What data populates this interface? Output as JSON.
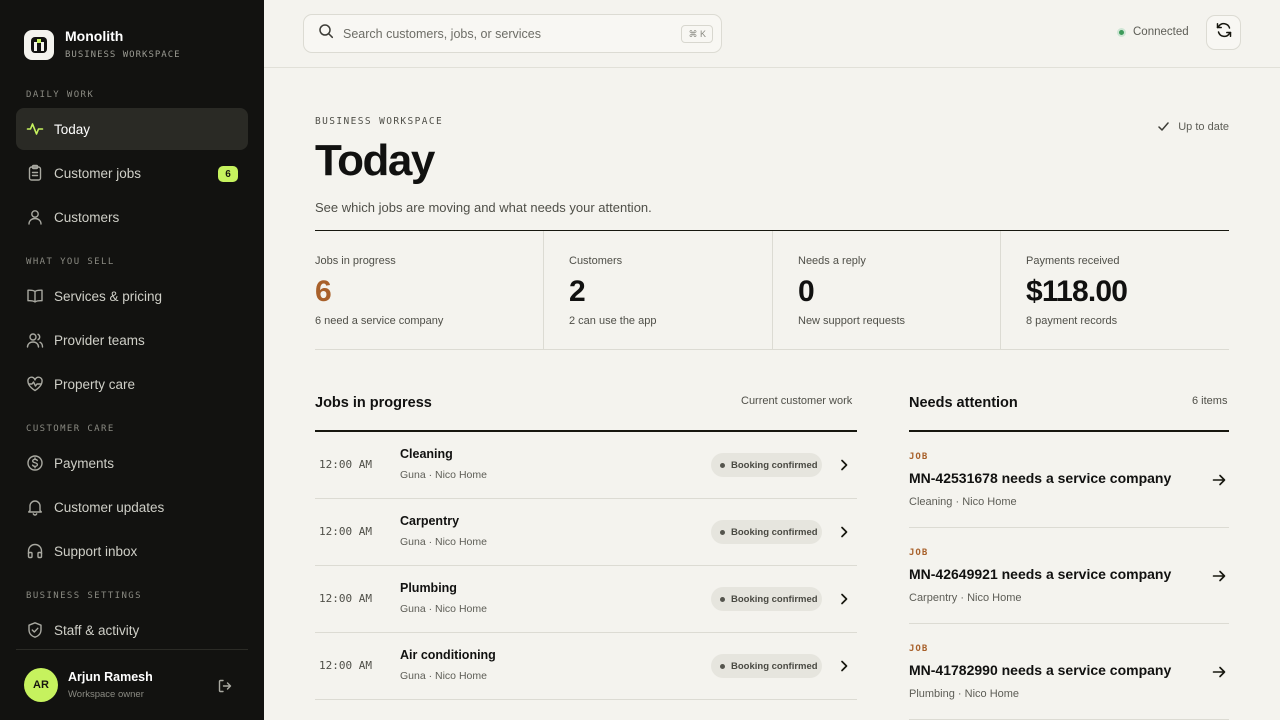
{
  "brand": {
    "name": "Monolith",
    "subtitle": "BUSINESS WORKSPACE"
  },
  "sidebar": {
    "sections": [
      {
        "label": "DAILY WORK"
      },
      {
        "label": "WHAT YOU SELL"
      },
      {
        "label": "CUSTOMER CARE"
      },
      {
        "label": "BUSINESS SETTINGS"
      }
    ],
    "items": [
      {
        "label": "Today",
        "icon": "activity-icon",
        "active": true
      },
      {
        "label": "Customer jobs",
        "icon": "clipboard-icon",
        "badge": "6"
      },
      {
        "label": "Customers",
        "icon": "user-icon"
      },
      {
        "label": "Services & pricing",
        "icon": "book-icon"
      },
      {
        "label": "Provider teams",
        "icon": "users-icon"
      },
      {
        "label": "Property care",
        "icon": "heart-pulse-icon"
      },
      {
        "label": "Payments",
        "icon": "dollar-circle-icon"
      },
      {
        "label": "Customer updates",
        "icon": "bell-icon"
      },
      {
        "label": "Support inbox",
        "icon": "headphones-icon"
      },
      {
        "label": "Staff & activity",
        "icon": "shield-icon"
      }
    ],
    "user": {
      "initials": "AR",
      "name": "Arjun Ramesh",
      "role": "Workspace owner"
    }
  },
  "topbar": {
    "search_placeholder": "Search customers, jobs, or services",
    "shortcut": "⌘ K",
    "status": "Connected",
    "status_color": "#3d9a5a"
  },
  "header": {
    "eyebrow": "BUSINESS WORKSPACE",
    "title": "Today",
    "subtitle": "See which jobs are moving and what needs your attention.",
    "sync_status": "Up to date"
  },
  "stats": [
    {
      "label": "Jobs in progress",
      "value": "6",
      "note": "6 need a service company",
      "accent": true
    },
    {
      "label": "Customers",
      "value": "2",
      "note": "2 can use the app"
    },
    {
      "label": "Needs a reply",
      "value": "0",
      "note": "New support requests"
    },
    {
      "label": "Payments received",
      "value": "$118.00",
      "note": "8 payment records"
    }
  ],
  "jobs_section": {
    "title": "Jobs in progress",
    "meta": "Current customer work",
    "rows": [
      {
        "time": "12:00 AM",
        "name": "Cleaning",
        "meta": "Guna · Nico Home",
        "status": "Booking confirmed"
      },
      {
        "time": "12:00 AM",
        "name": "Carpentry",
        "meta": "Guna · Nico Home",
        "status": "Booking confirmed"
      },
      {
        "time": "12:00 AM",
        "name": "Plumbing",
        "meta": "Guna · Nico Home",
        "status": "Booking confirmed"
      },
      {
        "time": "12:00 AM",
        "name": "Air conditioning",
        "meta": "Guna · Nico Home",
        "status": "Booking confirmed"
      }
    ]
  },
  "attention_section": {
    "title": "Needs attention",
    "meta": "6 items",
    "items": [
      {
        "tag": "JOB",
        "title": "MN-42531678 needs a service company",
        "meta": "Cleaning · Nico Home"
      },
      {
        "tag": "JOB",
        "title": "MN-42649921 needs a service company",
        "meta": "Carpentry · Nico Home"
      },
      {
        "tag": "JOB",
        "title": "MN-41782990 needs a service company",
        "meta": "Plumbing · Nico Home"
      }
    ]
  },
  "colors": {
    "accent": "#a8602a",
    "lime": "#c6f25e",
    "sidebar_bg": "#121210",
    "page_bg": "#f4f3ee"
  }
}
